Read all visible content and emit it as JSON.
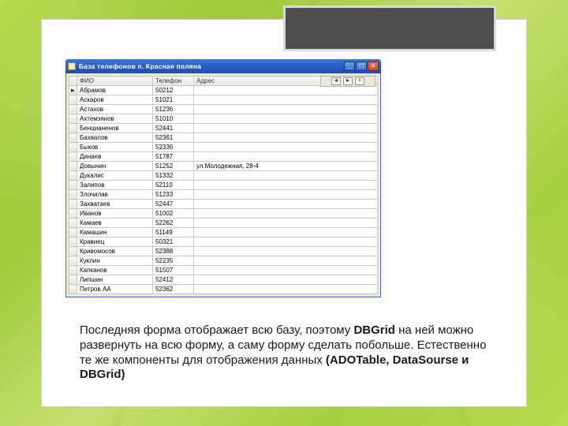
{
  "slide": {
    "window": {
      "title": "База телефонов п. Красная поляна",
      "columns": [
        "ФИО",
        "Телефон",
        "Адрес"
      ],
      "nav_buttons": [
        "◄",
        "►",
        "•"
      ],
      "rows": [
        {
          "marker": "►",
          "name": "Абрамов",
          "tel": "50212",
          "addr": ""
        },
        {
          "marker": "",
          "name": "Аскаров",
          "tel": "51021",
          "addr": ""
        },
        {
          "marker": "",
          "name": "Астахов",
          "tel": "51236",
          "addr": ""
        },
        {
          "marker": "",
          "name": "Ахтемзянов",
          "tel": "51010",
          "addr": ""
        },
        {
          "marker": "",
          "name": "Бенцианенов",
          "tel": "52441",
          "addr": ""
        },
        {
          "marker": "",
          "name": "Бахвалов",
          "tel": "52361",
          "addr": ""
        },
        {
          "marker": "",
          "name": "Быков",
          "tel": "52336",
          "addr": ""
        },
        {
          "marker": "",
          "name": "Динаев",
          "tel": "51787",
          "addr": ""
        },
        {
          "marker": "",
          "name": "Довынин",
          "tel": "51252",
          "addr": "ул.Молодежная, 28-4"
        },
        {
          "marker": "",
          "name": "Дукалис",
          "tel": "51332",
          "addr": ""
        },
        {
          "marker": "",
          "name": "Залипов",
          "tel": "52110",
          "addr": ""
        },
        {
          "marker": "",
          "name": "Злочилав",
          "tel": "51233",
          "addr": ""
        },
        {
          "marker": "",
          "name": "Захватаев",
          "tel": "52447",
          "addr": ""
        },
        {
          "marker": "",
          "name": "Иванов",
          "tel": "51002",
          "addr": ""
        },
        {
          "marker": "",
          "name": "Камаев",
          "tel": "52262",
          "addr": ""
        },
        {
          "marker": "",
          "name": "Камашин",
          "tel": "51149",
          "addr": ""
        },
        {
          "marker": "",
          "name": "Кравиец",
          "tel": "50321",
          "addr": ""
        },
        {
          "marker": "",
          "name": "Кривомосов",
          "tel": "52388",
          "addr": ""
        },
        {
          "marker": "",
          "name": "Куклин",
          "tel": "52235",
          "addr": ""
        },
        {
          "marker": "",
          "name": "Капканов",
          "tel": "51507",
          "addr": ""
        },
        {
          "marker": "",
          "name": "Липшин",
          "tel": "52412",
          "addr": ""
        },
        {
          "marker": "",
          "name": "Петров АА",
          "tel": "52362",
          "addr": ""
        }
      ]
    },
    "caption_parts": {
      "p1": "Последняя форма отображает всю базу, поэтому ",
      "b1": "DBGrid",
      "p2": " на ней можно развернуть на всю форму, а саму форму сделать побольше. Естественно те же компоненты для отображения данных ",
      "b2": "(ADOTable, DataSourse и DBGrid)"
    }
  }
}
